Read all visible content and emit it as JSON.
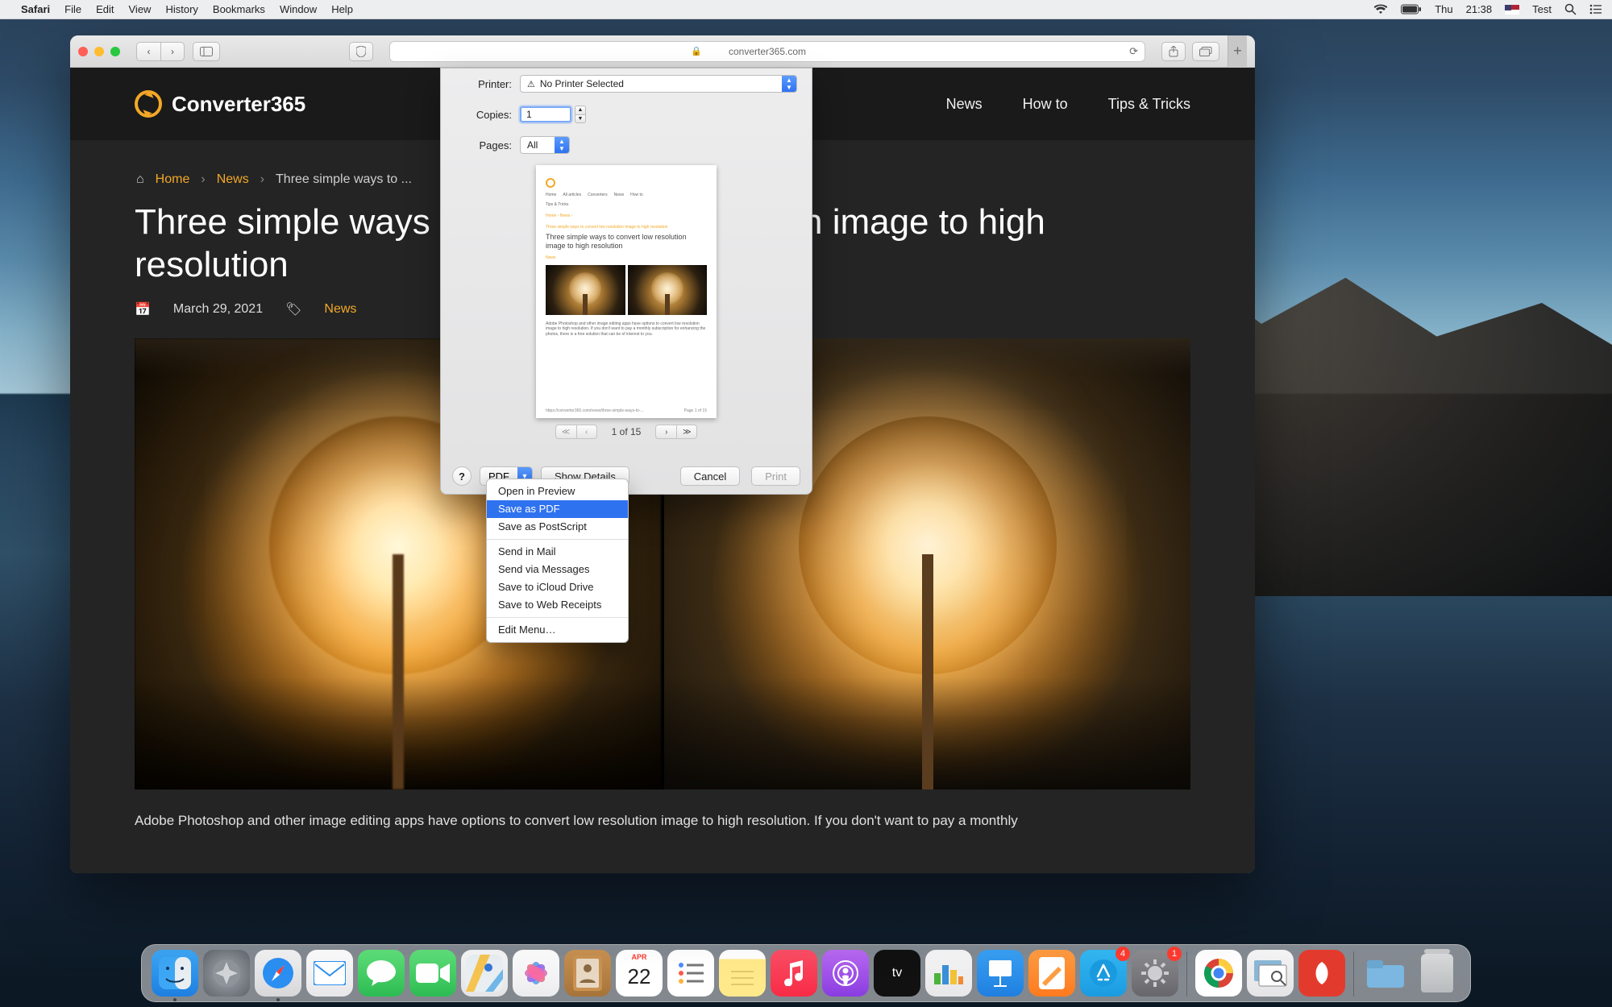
{
  "menubar": {
    "app": "Safari",
    "items": [
      "File",
      "Edit",
      "View",
      "History",
      "Bookmarks",
      "Window",
      "Help"
    ],
    "status": {
      "day": "Thu",
      "time": "21:38",
      "user": "Test"
    }
  },
  "safari": {
    "address": "converter365.com",
    "newsNav": [
      "News",
      "How to",
      "Tips & Tricks"
    ],
    "logoText": "Converter365",
    "breadcrumb": {
      "home": "Home",
      "news": "News",
      "current": "Three simple ways to ..."
    },
    "title": "Three simple ways to convert low resolution image to high resolution",
    "meta": {
      "date": "March 29, 2021",
      "category": "News"
    },
    "bodyStart": "Adobe Photoshop and other image editing apps have options to convert low resolution image to high resolution. If you don't want to pay a monthly"
  },
  "print": {
    "labels": {
      "printer": "Printer:",
      "copies": "Copies:",
      "pages": "Pages:"
    },
    "printerValue": "No Printer Selected",
    "copiesValue": "1",
    "pagesValue": "All",
    "pageIndicator": "1 of 15",
    "help": "?",
    "pdfLabel": "PDF",
    "showDetails": "Show Details",
    "cancel": "Cancel",
    "printBtn": "Print",
    "preview": {
      "nav": [
        "Home",
        "All articles",
        "Converters",
        "News",
        "How to"
      ],
      "tips": "Tips & Tricks",
      "bc": "Home › News ›",
      "bcline2": "Three simple ways to convert low resolution image to high resolution",
      "title": "Three simple ways to convert low resolution image to high resolution",
      "news": "News",
      "para": "Adobe Photoshop and other image editing apps have options to convert low resolution image to high resolution. If you don't want to pay a monthly subscription for enhancing the photos, there is a free solution that can be of interest to you.",
      "footUrl": "https://converter365.com/news/three-simple-ways-to-...",
      "footPage": "Page 1 of 15"
    }
  },
  "pdfMenu": {
    "group1": [
      "Open in Preview",
      "Save as PDF",
      "Save as PostScript"
    ],
    "group2": [
      "Send in Mail",
      "Send via Messages",
      "Save to iCloud Drive",
      "Save to Web Receipts"
    ],
    "group3": [
      "Edit Menu…"
    ],
    "selected": "Save as PDF"
  },
  "dock": {
    "calMonth": "APR",
    "calDay": "22",
    "badges": {
      "appstore": "4",
      "sysprefs": "1"
    },
    "running": [
      "finder",
      "safari"
    ]
  }
}
